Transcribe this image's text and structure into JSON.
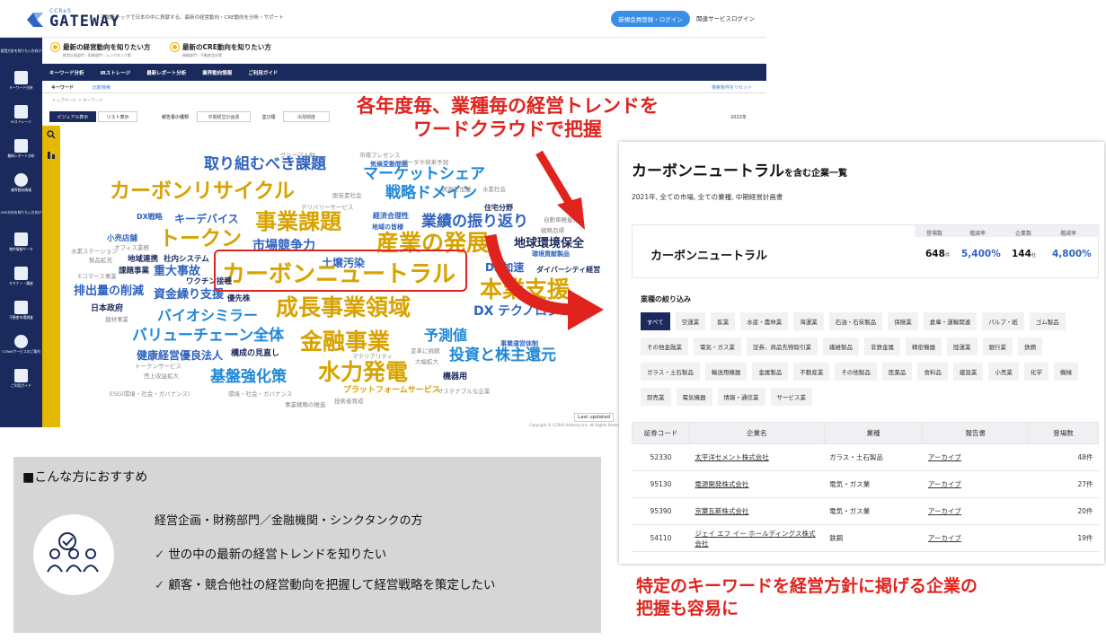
{
  "app": {
    "logo_small": "CCReS",
    "logo_name": "GATEWAY",
    "tagline": "不動産テックで日本の中に貢献する。最新の経営動向・CRE動向を分析・サポート",
    "register_button": "新規会員登録・ログイン",
    "related_login": "関連サービスログイン",
    "sidebar_items": [
      "経営方針を知りたい方向け",
      "キーワード分析",
      "IRストレージ",
      "最新レポート分析",
      "業界動向情報",
      "CRE方向を知りたい方向け",
      "物件情報サーチ",
      "セミナー・講座",
      "不動産市場調査",
      "CCReSサービスのご案内",
      "ご利用ガイド"
    ],
    "heading_1_title": "最新の経営動向を知りたい方",
    "heading_1_sub": "経営企画部門・財務部門・シンクタンク等",
    "heading_2_title": "最新のCRE動向を知りたい方",
    "heading_2_sub": "総務部門・不動産会社等",
    "nav_items": [
      "キーワード分析",
      "IRストレージ",
      "最新レポート分析",
      "業界動向情報",
      "ご利用ガイド"
    ],
    "tab_keyword": "キーワード",
    "tab_compare": "比較検索",
    "tab_reset": "検索条件をリセット",
    "breadcrumb": "トップページ ＞ キーワード",
    "view_visual": "ビジュアル表示",
    "view_list": "リスト表示",
    "report_type_label": "報告書の種類",
    "report_type_value": "中期経営計画書",
    "sort_label": "並び順",
    "sort_value": "出現頻度",
    "year_value": "2022年",
    "search_icon": "search-icon",
    "last_updated": "Last updated",
    "copyright": "Copyright © CCReS Advisory Inc. All Rights Reserved."
  },
  "word_cloud": [
    {
      "text": "取り組むべき課題",
      "color": "#2f63c1"
    },
    {
      "text": "マーケットシェア",
      "color": "#1e88d8"
    },
    {
      "text": "カーボンリサイクル",
      "color": "#d8a300"
    },
    {
      "text": "戦略ドメイン",
      "color": "#1e88d8"
    },
    {
      "text": "事業課題",
      "color": "#d8a300"
    },
    {
      "text": "キーデバイス",
      "color": "#2f63c1"
    },
    {
      "text": "業績の振り返り",
      "color": "#2f63c1"
    },
    {
      "text": "トークン",
      "color": "#d8a300"
    },
    {
      "text": "市場競争力",
      "color": "#2f63c1"
    },
    {
      "text": "産業の発展",
      "color": "#d8a300"
    },
    {
      "text": "地球環境保全",
      "color": "#1b2a5c"
    },
    {
      "text": "土壌汚染",
      "color": "#2f63c1"
    },
    {
      "text": "DX加速",
      "color": "#2f63c1"
    },
    {
      "text": "ダイバーシティ経営",
      "color": "#1b2a5c"
    },
    {
      "text": "カーボンニュートラル",
      "color": "#d8a300"
    },
    {
      "text": "重大事故",
      "color": "#2f63c1"
    },
    {
      "text": "本業支援",
      "color": "#d8a300"
    },
    {
      "text": "排出量の削減",
      "color": "#2f63c1"
    },
    {
      "text": "資金繰り支援",
      "color": "#2f63c1"
    },
    {
      "text": "成長事業領域",
      "color": "#d8a300"
    },
    {
      "text": "DX",
      "color": "#2f63c1"
    },
    {
      "text": "テクノロジー",
      "color": "#2f63c1"
    },
    {
      "text": "バイオシミラー",
      "color": "#1e88d8"
    },
    {
      "text": "日本政府",
      "color": "#1b2a5c"
    },
    {
      "text": "バリューチェーン全体",
      "color": "#1e88d8"
    },
    {
      "text": "金融事業",
      "color": "#d8a300"
    },
    {
      "text": "予測値",
      "color": "#1e88d8"
    },
    {
      "text": "健康経営優良法人",
      "color": "#2f63c1"
    },
    {
      "text": "投資と株主還元",
      "color": "#1e88d8"
    },
    {
      "text": "基盤強化策",
      "color": "#1e88d8"
    },
    {
      "text": "水力発電",
      "color": "#d8a300"
    },
    {
      "text": "機器用",
      "color": "#1b2a5c"
    },
    {
      "text": "プラットフォームサービス",
      "color": "#d8a300"
    },
    {
      "text": "ワクチン接種",
      "color": "#1b2a5c"
    },
    {
      "text": "地域連携",
      "color": "#1b2a5c"
    },
    {
      "text": "社内システム",
      "color": "#1b2a5c"
    },
    {
      "text": "課題事業",
      "color": "#1b2a5c"
    },
    {
      "text": "優先株",
      "color": "#1b2a5c"
    },
    {
      "text": "小売店舗",
      "color": "#2f63c1"
    },
    {
      "text": "構成の見直し",
      "color": "#1b2a5c"
    },
    {
      "text": "経済合理性",
      "color": "#2f63c1"
    },
    {
      "text": "気候変動問題",
      "color": "#2f63c1"
    },
    {
      "text": "住宅分野",
      "color": "#1b2a5c"
    },
    {
      "text": "環境貢献製品",
      "color": "#2f63c1"
    },
    {
      "text": "事業運営体制",
      "color": "#2f63c1"
    },
    {
      "text": "地域の皆様",
      "color": "#2f63c1"
    },
    {
      "text": "DX戦略",
      "color": "#2f63c1"
    },
    {
      "text": "ESG(環境・社会・ガバナンス)",
      "color": "#888888"
    },
    {
      "text": "環境・社会・ガバナンス",
      "color": "#888888"
    },
    {
      "text": "サステナブルな企業",
      "color": "#888888"
    },
    {
      "text": "グループ人財",
      "color": "#888888"
    },
    {
      "text": "市場プレゼンス",
      "color": "#888888"
    },
    {
      "text": "データや将来予測",
      "color": "#888888"
    },
    {
      "text": "デリバリーサービス",
      "color": "#888888"
    },
    {
      "text": "脱炭素社会",
      "color": "#888888"
    },
    {
      "text": "水素社会",
      "color": "#888888"
    },
    {
      "text": "実現を加速",
      "color": "#888888"
    },
    {
      "text": "自動車軽量化",
      "color": "#888888"
    },
    {
      "text": "戦略目標",
      "color": "#888888"
    },
    {
      "text": "水素ステーション",
      "color": "#888888"
    },
    {
      "text": "オフィス業務",
      "color": "#888888"
    },
    {
      "text": "製品拡充",
      "color": "#888888"
    },
    {
      "text": "Eコマース事業",
      "color": "#888888"
    },
    {
      "text": "建材事業",
      "color": "#888888"
    },
    {
      "text": "トークンサービス",
      "color": "#888888"
    },
    {
      "text": "売上収益拡大",
      "color": "#888888"
    },
    {
      "text": "マテリアリティ",
      "color": "#888888"
    },
    {
      "text": "変革に挑戦",
      "color": "#888888"
    },
    {
      "text": "大幅拡大",
      "color": "#888888"
    },
    {
      "text": "技術者育成",
      "color": "#888888"
    },
    {
      "text": "事業戦略の推進",
      "color": "#888888"
    }
  ],
  "callouts": {
    "top_line1": "各年度毎、業種毎の経営トレンドを",
    "top_line2": "ワードクラウドで把握",
    "bottom_line1": "特定のキーワードを経営方針に掲げる企業の",
    "bottom_line2": "把握も容易に"
  },
  "panel": {
    "title": "カーボンニュートラル",
    "title_suffix": "を含む企業一覧",
    "subtitle": "2021年, 全ての市場, 全ての業種, 中期経営計画書",
    "keyword": "カーボンニュートラル",
    "stats": [
      {
        "header": "登場数",
        "value": "648",
        "unit": "件"
      },
      {
        "header": "増減率",
        "value": "5,400%",
        "unit": ""
      },
      {
        "header": "企業数",
        "value": "144",
        "unit": "社"
      },
      {
        "header": "増減率",
        "value": "4,800%",
        "unit": ""
      }
    ],
    "filter_title": "業種の絞り込み",
    "industries": [
      "すべて",
      "空運業",
      "鉱業",
      "水産・農林業",
      "海運業",
      "石油・石炭製品",
      "保険業",
      "倉庫・運輸関連",
      "パルプ・紙",
      "ゴム製品",
      "その他金融業",
      "電気・ガス業",
      "証券、商品先物取引業",
      "繊維製品",
      "非鉄金属",
      "精密機器",
      "陸運業",
      "銀行業",
      "鉄鋼",
      "ガラス・土石製品",
      "輸送用機器",
      "金属製品",
      "不動産業",
      "その他製品",
      "医薬品",
      "食料品",
      "建設業",
      "小売業",
      "化学",
      "機械",
      "卸売業",
      "電気機器",
      "情報・通信業",
      "サービス業"
    ],
    "table_headers": [
      "証券コード",
      "企業名",
      "業種",
      "報告書",
      "登場数"
    ],
    "rows": [
      {
        "code": "52330",
        "name": "太平洋セメント株式会社",
        "industry": "ガラス・土石製品",
        "report": "アーカイブ",
        "count": "48件"
      },
      {
        "code": "95130",
        "name": "電源開発株式会社",
        "industry": "電気・ガス業",
        "report": "アーカイブ",
        "count": "27件"
      },
      {
        "code": "95390",
        "name": "京葉瓦斯株式会社",
        "industry": "電気・ガス業",
        "report": "アーカイブ",
        "count": "20件"
      },
      {
        "code": "54110",
        "name": "ジェイ エフ イー ホールディングス株式会社",
        "industry": "鉄鋼",
        "report": "アーカイブ",
        "count": "19件"
      }
    ]
  },
  "recommend": {
    "heading": "■こんな方におすすめ",
    "target": "経営企画・財務部門／金融機関・シンクタンクの方",
    "item1": "世の中の最新の経営トレンドを知りたい",
    "item2": "顧客・競合他社の経営動向を把握して経営戦略を策定したい",
    "check": "✓",
    "icon": "team-check-icon"
  },
  "colors": {
    "navy": "#1b2a5c",
    "accent_blue": "#3a8ee6",
    "gold": "#e4b700",
    "red": "#e0231d"
  }
}
